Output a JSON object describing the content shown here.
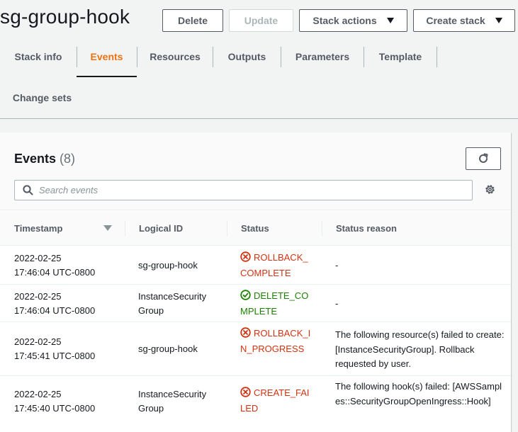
{
  "header": {
    "title": "sg-group-hook",
    "buttons": {
      "delete": "Delete",
      "update": "Update",
      "stack_actions": "Stack actions",
      "create_stack": "Create stack"
    }
  },
  "tabs": [
    {
      "label": "Stack info"
    },
    {
      "label": "Events"
    },
    {
      "label": "Resources"
    },
    {
      "label": "Outputs"
    },
    {
      "label": "Parameters"
    },
    {
      "label": "Template"
    },
    {
      "label": "Change sets"
    }
  ],
  "events": {
    "title": "Events",
    "count": "(8)",
    "search": {
      "placeholder": "Search events"
    },
    "columns": {
      "timestamp": "Timestamp",
      "logical_id": "Logical ID",
      "status": "Status",
      "status_reason": "Status reason"
    },
    "rows": [
      {
        "date": "2022-02-25",
        "time": "17:46:04 UTC-0800",
        "logical_id": "sg-group-hook",
        "status": "ROLLBACK_COMPLETE",
        "status_kind": "error",
        "reason": "-"
      },
      {
        "date": "2022-02-25",
        "time": "17:46:04 UTC-0800",
        "logical_id": "InstanceSecurityGroup",
        "status": "DELETE_COMPLETE",
        "status_kind": "success",
        "reason": "-"
      },
      {
        "date": "2022-02-25",
        "time": "17:45:41 UTC-0800",
        "logical_id": "sg-group-hook",
        "status": "ROLLBACK_IN_PROGRESS",
        "status_kind": "error",
        "reason": "The following resource(s) failed to create: [InstanceSecurityGroup]. Rollback requested by user."
      },
      {
        "date": "2022-02-25",
        "time": "17:45:40 UTC-0800",
        "logical_id": "InstanceSecurityGroup",
        "status": "CREATE_FAILED",
        "status_kind": "error",
        "reason": "The following hook(s) failed: [AWSSamples::SecurityGroupOpenIngress::Hook]"
      }
    ]
  },
  "colors": {
    "accent": "#ec7211",
    "error": "#d13212",
    "success": "#1d8102"
  },
  "icons": {
    "refresh": "refresh-icon",
    "search": "search-icon",
    "settings": "gear-icon",
    "error": "status-error-icon",
    "success": "status-success-icon",
    "dropdown": "caret-down-icon",
    "sort": "sort-descending-icon"
  }
}
